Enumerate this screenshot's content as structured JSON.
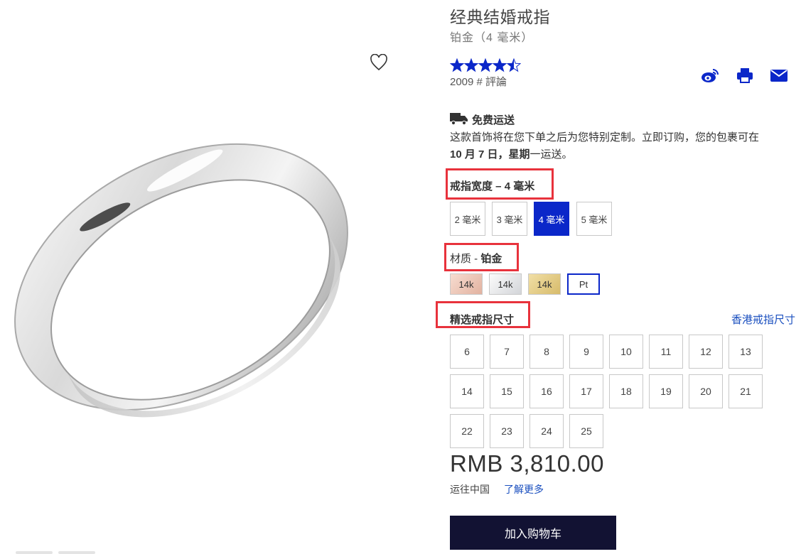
{
  "product": {
    "title": "经典结婚戒指",
    "subtitle": "铂金（4 毫米）",
    "rating": 4.5,
    "rating_max": 5,
    "review_count_label": "2009 # 評論"
  },
  "share": {
    "icons": [
      "weibo-icon",
      "print-icon",
      "email-icon"
    ]
  },
  "shipping": {
    "title": "免费运送",
    "desc": "这款首饰将在您下单之后为您特别定制。立即订购，您的包裹可在",
    "date_bold": "10 月 7 日，星期",
    "date_suffix": "一运送。"
  },
  "width_section": {
    "label": "戒指宽度 – ",
    "value": "4 毫米",
    "options": [
      {
        "label": "2 毫米",
        "selected": false
      },
      {
        "label": "3 毫米",
        "selected": false
      },
      {
        "label": "4 毫米",
        "selected": true
      },
      {
        "label": "5 毫米",
        "selected": false
      }
    ]
  },
  "metal_section": {
    "label": "材质  - ",
    "value": "铂金",
    "options": [
      {
        "label": "14k",
        "finish": "rose-gold"
      },
      {
        "label": "14k",
        "finish": "white-gold"
      },
      {
        "label": "14k",
        "finish": "yellow-gold"
      },
      {
        "label": "Pt",
        "finish": "platinum",
        "selected": true
      }
    ]
  },
  "size_section": {
    "label": "精选戒指尺寸",
    "guide_link": "香港戒指尺寸",
    "sizes": [
      "6",
      "7",
      "8",
      "9",
      "10",
      "11",
      "12",
      "13",
      "14",
      "15",
      "16",
      "17",
      "18",
      "19",
      "20",
      "21",
      "22",
      "23",
      "24",
      "25"
    ]
  },
  "price": "RMB 3,810.00",
  "ship_to": "运往中国",
  "learn_more": "了解更多",
  "add_to_cart": "加入购物车",
  "colors": {
    "accent": "#0b27c9",
    "button": "#121233",
    "highlight_box": "#e8323c",
    "link": "#1a4fbf"
  }
}
